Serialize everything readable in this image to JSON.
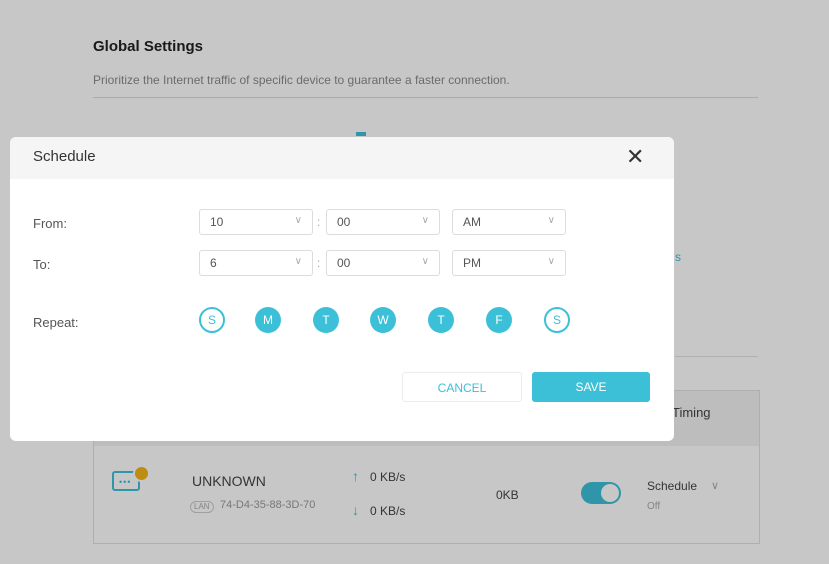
{
  "global_settings": {
    "title": "Global Settings",
    "subtitle": "Prioritize the Internet traffic of specific device to guarantee a faster connection."
  },
  "background_link_fragment": "s",
  "device_table": {
    "timing_header_fragment": "Timing",
    "row": {
      "name": "UNKNOWN",
      "lan_chip": "LAN",
      "mac": "74-D4-35-88-3D-70",
      "upload": "0 KB/s",
      "download": "0 KB/s",
      "traffic": "0KB",
      "priority_enabled": true,
      "schedule_label": "Schedule",
      "schedule_state": "Off"
    }
  },
  "schedule_modal": {
    "title": "Schedule",
    "from_label": "From:",
    "to_label": "To:",
    "repeat_label": "Repeat:",
    "from": {
      "hour": "10",
      "minute": "00",
      "ampm": "AM"
    },
    "to": {
      "hour": "6",
      "minute": "00",
      "ampm": "PM"
    },
    "days": [
      {
        "label": "S",
        "selected": false
      },
      {
        "label": "M",
        "selected": true
      },
      {
        "label": "T",
        "selected": true
      },
      {
        "label": "W",
        "selected": true
      },
      {
        "label": "T",
        "selected": true
      },
      {
        "label": "F",
        "selected": true
      },
      {
        "label": "S",
        "selected": false
      }
    ],
    "cancel_label": "CANCEL",
    "save_label": "SAVE"
  },
  "colors": {
    "accent": "#3cc0d8",
    "badge": "#f2b417"
  },
  "icons": {
    "close": "close-icon",
    "chevron": "chevron-down-icon",
    "device": "device-icon",
    "upload": "arrow-up-icon",
    "download": "arrow-down-icon"
  }
}
